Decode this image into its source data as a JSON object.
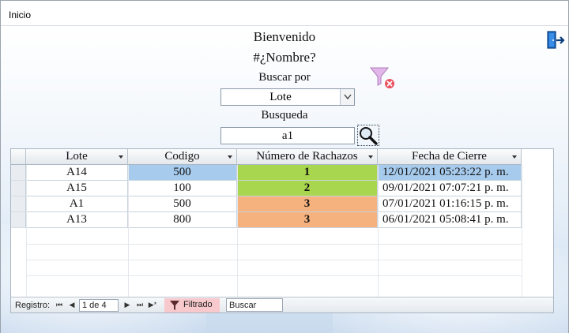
{
  "window": {
    "title": "Inicio"
  },
  "header": {
    "welcome": "Bienvenido",
    "user_name": "#¿Nombre?"
  },
  "search": {
    "buscar_por_label": "Buscar por",
    "buscar_por_value": "Lote",
    "busqueda_label": "Busqueda",
    "busqueda_value": "a1"
  },
  "table": {
    "columns": [
      "Lote",
      "Codigo",
      "Número de Rachazos",
      "Fecha de Cierre"
    ],
    "rows": [
      {
        "lote": "A14",
        "codigo": "500",
        "rechazos": "1",
        "fecha": "12/01/2021 05:23:22 p. m."
      },
      {
        "lote": "A15",
        "codigo": "100",
        "rechazos": "2",
        "fecha": "09/01/2021 07:07:21 p. m."
      },
      {
        "lote": "A1",
        "codigo": "500",
        "rechazos": "3",
        "fecha": "07/01/2021 01:16:15 p. m."
      },
      {
        "lote": "A13",
        "codigo": "800",
        "rechazos": "3",
        "fecha": "06/01/2021 05:08:41 p. m."
      }
    ]
  },
  "navigation": {
    "registro_label": "Registro:",
    "position": "1 de 4",
    "filter_status": "Filtrado",
    "search_placeholder": "Buscar"
  },
  "icons": {
    "exit": "exit-door-icon",
    "clear_filter": "clear-filter-icon",
    "search": "magnifier-icon"
  },
  "colors": {
    "selected_cell": "#a7cbed",
    "rechazos_low": "#a9d64f",
    "rechazos_high": "#f6b27e",
    "filtrado_bg": "#f7c9cd"
  }
}
